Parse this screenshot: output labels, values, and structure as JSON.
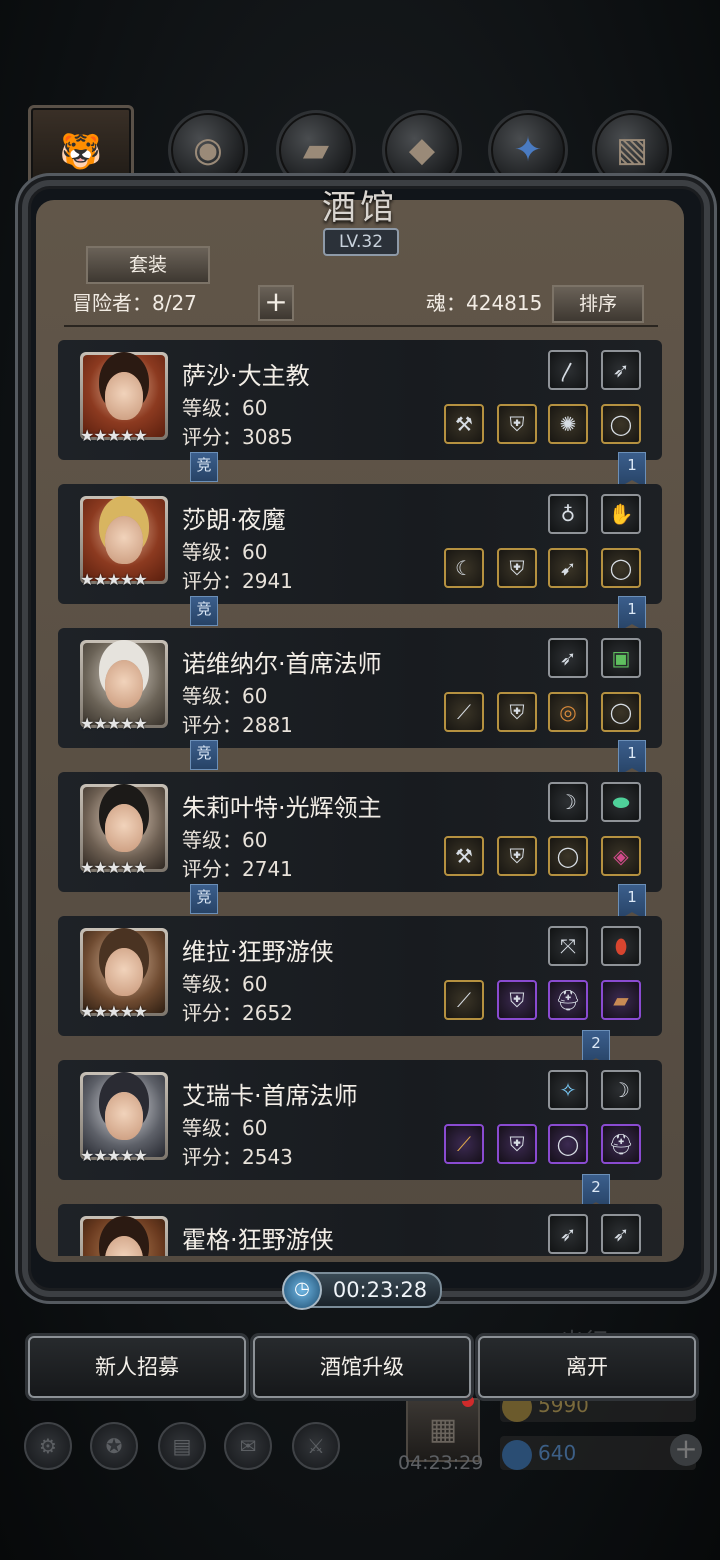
{
  "header": {
    "title": "酒馆",
    "level": "LV.32"
  },
  "toolbar": {
    "set_label": "套装",
    "adventurers": "冒险者：8/27",
    "add_symbol": "+",
    "soul": "魂：424815",
    "sort_label": "排序"
  },
  "heroes": [
    {
      "name": "萨沙·大主教",
      "level": "等级：60",
      "score": "评分：3085",
      "stars": "★★★★★",
      "rank": "1",
      "tag": "竞"
    },
    {
      "name": "莎朗·夜魔",
      "level": "等级：60",
      "score": "评分：2941",
      "stars": "★★★★★",
      "rank": "1",
      "tag": "竞"
    },
    {
      "name": "诺维纳尔·首席法师",
      "level": "等级：60",
      "score": "评分：2881",
      "stars": "★★★★★",
      "rank": "1",
      "tag": "竞"
    },
    {
      "name": "朱莉叶特·光辉领主",
      "level": "等级：60",
      "score": "评分：2741",
      "stars": "★★★★★",
      "rank": "1",
      "tag": "竞"
    },
    {
      "name": "维拉·狂野游侠",
      "level": "等级：60",
      "score": "评分：2652",
      "stars": "★★★★★",
      "rank": "2"
    },
    {
      "name": "艾瑞卡·首席法师",
      "level": "等级：60",
      "score": "评分：2543",
      "stars": "★★★★★",
      "rank": "2"
    },
    {
      "name": "霍格·狂野游侠"
    }
  ],
  "timer": {
    "value": "00:23:28"
  },
  "actions": {
    "recruit": "新人招募",
    "upgrade": "酒馆升级",
    "leave": "离开"
  },
  "background_hud": {
    "gift_timer": "04:23:29",
    "gold": "5990",
    "gems": "640",
    "depart": "出行"
  }
}
